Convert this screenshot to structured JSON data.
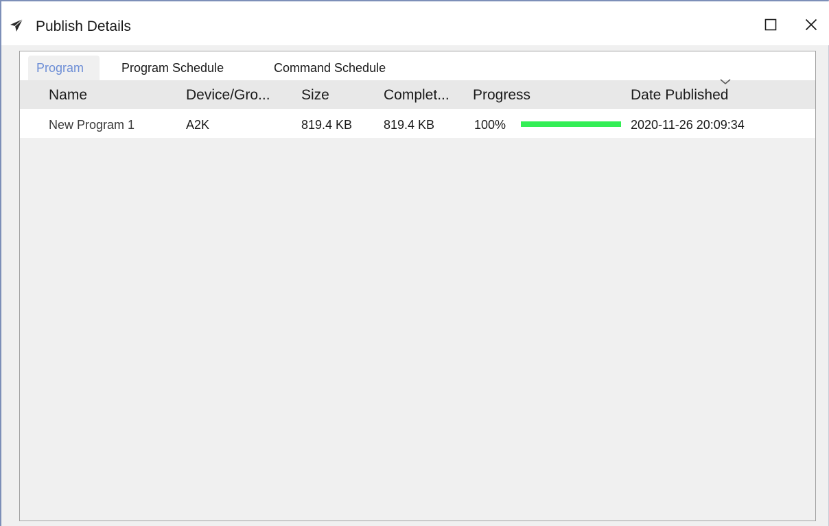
{
  "window": {
    "title": "Publish Details",
    "icons": {
      "app": "paper-plane-icon",
      "maximize": "maximize-icon",
      "close": "close-icon"
    }
  },
  "tabs": [
    {
      "label": "Program",
      "active": true
    },
    {
      "label": "Program Schedule",
      "active": false
    },
    {
      "label": "Command Schedule",
      "active": false
    }
  ],
  "table": {
    "columns": [
      "Name",
      "Device/Gro...",
      "Size",
      "Complet...",
      "Progress",
      "Date Published"
    ],
    "sort_column": "Date Published",
    "sort_icon": "chevron-down-icon",
    "rows": [
      {
        "name": "New Program 1",
        "device": "A2K",
        "size": "819.4 KB",
        "completed": "819.4 KB",
        "progress_text": "100%",
        "progress_value": 100,
        "date_published": "2020-11-26 20:09:34"
      }
    ]
  },
  "colors": {
    "accent": "#6d8ed6",
    "progress": "#33ee55",
    "window_border": "#7d8fb8"
  }
}
